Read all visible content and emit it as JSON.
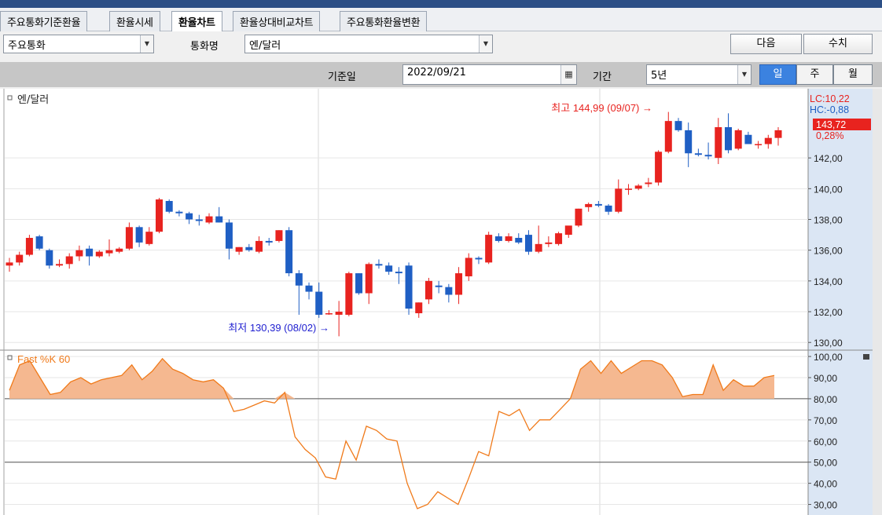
{
  "tabs": [
    "주요통화기준환율",
    "환율시세",
    "환율차트",
    "환율상대비교차트",
    "주요통화환율변환"
  ],
  "active_tab": "환율차트",
  "toolbar": {
    "category_value": "주요통화",
    "currency_label": "통화명",
    "currency_value": "엔/달러",
    "next_label": "다음",
    "numeric_label": "수치",
    "date_label": "기준일",
    "date_value": "2022/09/21",
    "period_label": "기간",
    "period_value": "5년",
    "interval_buttons": [
      "일",
      "주",
      "월"
    ],
    "active_interval": "일"
  },
  "chart_data": [
    {
      "type": "candlestick",
      "title": "엔/달러",
      "ylim": [
        129.5,
        146.5
      ],
      "y_ticks": [
        "142,00",
        "140,00",
        "138,00",
        "136,00",
        "134,00",
        "132,00",
        "130,00"
      ],
      "info_lc": "LC:10,22",
      "info_hc": "HC:-0,88",
      "last_price": "143,72",
      "change_pct": "0,28%",
      "annotation_high": "최고 144,99 (09/07) →",
      "annotation_low": "최저 130,39 (08/02) →",
      "colors": {
        "up": "#e8231f",
        "down": "#1f5fc4",
        "annot_low": "#2020d0"
      },
      "candles": [
        [
          135.0,
          135.5,
          134.6,
          135.2
        ],
        [
          135.2,
          135.9,
          135.0,
          135.7
        ],
        [
          135.7,
          137.0,
          135.6,
          136.8
        ],
        [
          136.9,
          137.0,
          136.0,
          136.1
        ],
        [
          136.0,
          136.1,
          134.8,
          135.0
        ],
        [
          135.0,
          135.4,
          134.9,
          135.1
        ],
        [
          135.1,
          135.8,
          134.8,
          135.6
        ],
        [
          135.6,
          136.3,
          135.3,
          136.0
        ],
        [
          136.1,
          136.3,
          135.0,
          135.6
        ],
        [
          135.6,
          136.0,
          135.5,
          135.9
        ],
        [
          135.8,
          136.7,
          135.6,
          136.0
        ],
        [
          135.9,
          136.2,
          135.8,
          136.1
        ],
        [
          136.1,
          137.8,
          136.0,
          137.5
        ],
        [
          137.5,
          137.6,
          136.2,
          136.5
        ],
        [
          136.4,
          137.5,
          136.3,
          137.2
        ],
        [
          137.2,
          139.4,
          137.1,
          139.3
        ],
        [
          139.2,
          139.3,
          138.4,
          138.5
        ],
        [
          138.5,
          138.6,
          138.2,
          138.4
        ],
        [
          138.4,
          138.5,
          137.7,
          138.0
        ],
        [
          138.0,
          138.3,
          137.6,
          137.9
        ],
        [
          137.8,
          138.4,
          137.7,
          138.2
        ],
        [
          138.2,
          138.8,
          137.8,
          137.8
        ],
        [
          137.8,
          138.0,
          135.4,
          136.1
        ],
        [
          135.9,
          136.2,
          135.7,
          136.2
        ],
        [
          136.2,
          136.4,
          135.9,
          136.0
        ],
        [
          135.9,
          136.9,
          135.8,
          136.6
        ],
        [
          136.6,
          136.8,
          136.3,
          136.5
        ],
        [
          136.6,
          137.3,
          136.5,
          137.3
        ],
        [
          137.3,
          137.5,
          134.3,
          134.5
        ],
        [
          134.5,
          134.7,
          131.8,
          133.7
        ],
        [
          133.7,
          133.9,
          132.8,
          133.3
        ],
        [
          133.3,
          133.9,
          131.6,
          131.8
        ],
        [
          131.9,
          132.1,
          131.8,
          131.9
        ],
        [
          131.8,
          132.7,
          130.4,
          132.0
        ],
        [
          131.8,
          134.6,
          131.7,
          134.5
        ],
        [
          134.5,
          134.5,
          133.1,
          133.2
        ],
        [
          133.2,
          135.2,
          132.5,
          135.1
        ],
        [
          135.1,
          135.4,
          134.8,
          135.0
        ],
        [
          135.0,
          135.2,
          134.4,
          134.6
        ],
        [
          134.6,
          134.9,
          133.8,
          134.5
        ],
        [
          135.0,
          135.2,
          131.8,
          132.2
        ],
        [
          131.9,
          132.6,
          131.6,
          132.6
        ],
        [
          132.8,
          134.2,
          132.5,
          134.0
        ],
        [
          133.7,
          134.0,
          133.2,
          133.6
        ],
        [
          133.6,
          133.8,
          132.6,
          133.1
        ],
        [
          133.1,
          134.9,
          132.5,
          134.5
        ],
        [
          134.3,
          135.8,
          134.0,
          135.5
        ],
        [
          135.5,
          135.6,
          135.1,
          135.4
        ],
        [
          135.2,
          137.2,
          135.1,
          137.0
        ],
        [
          136.9,
          137.1,
          136.5,
          136.6
        ],
        [
          136.6,
          137.1,
          136.5,
          136.9
        ],
        [
          136.8,
          137.1,
          136.4,
          136.5
        ],
        [
          137.0,
          137.3,
          135.7,
          135.9
        ],
        [
          135.9,
          137.6,
          135.8,
          136.4
        ],
        [
          136.4,
          136.9,
          136.2,
          136.5
        ],
        [
          136.4,
          137.2,
          136.3,
          137.1
        ],
        [
          137.0,
          137.5,
          136.8,
          137.6
        ],
        [
          137.6,
          138.7,
          137.5,
          138.7
        ],
        [
          138.8,
          139.1,
          138.5,
          139.0
        ],
        [
          139.0,
          139.2,
          138.8,
          138.9
        ],
        [
          138.9,
          139.0,
          138.3,
          138.5
        ],
        [
          138.5,
          140.6,
          138.4,
          140.0
        ],
        [
          140.0,
          140.3,
          139.6,
          140.0
        ],
        [
          140.0,
          140.3,
          139.9,
          140.2
        ],
        [
          140.3,
          140.7,
          140.1,
          140.4
        ],
        [
          140.4,
          142.5,
          140.2,
          142.4
        ],
        [
          142.4,
          144.99,
          142.3,
          144.4
        ],
        [
          144.4,
          144.6,
          143.7,
          143.8
        ],
        [
          143.8,
          144.3,
          141.4,
          142.3
        ],
        [
          142.3,
          142.6,
          142.1,
          142.2
        ],
        [
          142.2,
          143.0,
          141.9,
          142.1
        ],
        [
          142.0,
          144.6,
          141.6,
          144.0
        ],
        [
          144.0,
          144.9,
          142.3,
          142.5
        ],
        [
          142.6,
          143.9,
          142.5,
          143.8
        ],
        [
          143.5,
          143.7,
          142.9,
          142.9
        ],
        [
          142.9,
          143.1,
          142.6,
          142.9
        ],
        [
          142.9,
          143.5,
          142.6,
          143.3
        ],
        [
          143.3,
          144.0,
          142.8,
          143.8
        ]
      ]
    },
    {
      "type": "line",
      "title": "Fast %K 60",
      "ylim": [
        25,
        103
      ],
      "y_ticks": [
        "100,00",
        "90,00",
        "80,00",
        "70,00",
        "60,00",
        "50,00",
        "40,00",
        "30,00"
      ],
      "reference_lines": [
        80,
        50
      ],
      "colors": {
        "line": "#f07a1a",
        "fill": "#f5b890"
      },
      "values": [
        84,
        96,
        98,
        90,
        82,
        83,
        88,
        90,
        87,
        89,
        90,
        91,
        96,
        89,
        93,
        99,
        94,
        92,
        89,
        88,
        89,
        85,
        74,
        75,
        77,
        79,
        78,
        83,
        62,
        56,
        52,
        43,
        42,
        60,
        51,
        67,
        65,
        61,
        60,
        40,
        28,
        30,
        36,
        33,
        30,
        42,
        55,
        53,
        74,
        72,
        75,
        65,
        70,
        70,
        75,
        80,
        94,
        98,
        92,
        98,
        92,
        95,
        98,
        98,
        96,
        90,
        81,
        82,
        82,
        96,
        84,
        89,
        86,
        86,
        90,
        91
      ]
    }
  ]
}
